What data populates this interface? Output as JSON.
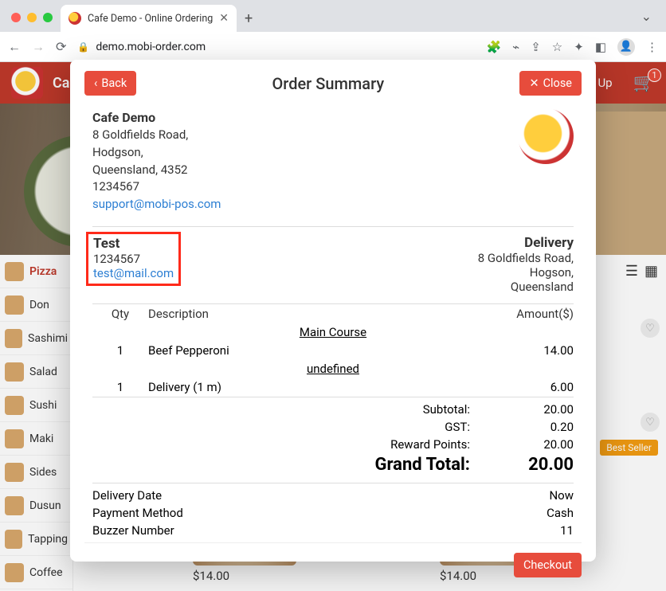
{
  "browser": {
    "tab_title": "Cafe Demo - Online Ordering",
    "url": "demo.mobi-order.com"
  },
  "header": {
    "brand_prefix": "Ca",
    "signup": "ng Up",
    "cart_count": "1"
  },
  "sidebar": {
    "items": [
      {
        "label": "Pizza"
      },
      {
        "label": "Don"
      },
      {
        "label": "Sashimi"
      },
      {
        "label": "Salad"
      },
      {
        "label": "Sushi"
      },
      {
        "label": "Maki"
      },
      {
        "label": "Sides"
      },
      {
        "label": "Dusun"
      },
      {
        "label": "Tapping"
      },
      {
        "label": "Coffee"
      }
    ]
  },
  "products": {
    "price": "$14.00",
    "best_seller": "Best Seller"
  },
  "modal": {
    "back": "Back",
    "close": "Close",
    "title": "Order Summary",
    "checkout": "Checkout",
    "store": {
      "name": "Cafe Demo",
      "addr1": "8 Goldfields Road,",
      "addr2": "Hodgson,",
      "addr3": "Queensland, 4352",
      "phone": "1234567",
      "email": "support@mobi-pos.com"
    },
    "customer": {
      "name": "Test",
      "phone": "1234567",
      "email": "test@mail.com"
    },
    "delivery": {
      "title": "Delivery",
      "addr1": "8 Goldfields Road,",
      "addr2": "Hogson,",
      "addr3": "Queensland"
    },
    "table": {
      "h_qty": "Qty",
      "h_desc": "Description",
      "h_amt": "Amount($)",
      "sec1": "Main Course",
      "r1_qty": "1",
      "r1_desc": "Beef Pepperoni",
      "r1_amt": "14.00",
      "sec2": "undefined",
      "r2_qty": "1",
      "r2_desc": "Delivery (1 m)",
      "r2_amt": "6.00"
    },
    "totals": {
      "subtotal_l": "Subtotal:",
      "subtotal_v": "20.00",
      "gst_l": "GST:",
      "gst_v": "0.20",
      "reward_l": "Reward Points:",
      "reward_v": "20.00",
      "grand_l": "Grand Total:",
      "grand_v": "20.00"
    },
    "meta": {
      "date_l": "Delivery Date",
      "date_v": "Now",
      "pay_l": "Payment Method",
      "pay_v": "Cash",
      "buzz_l": "Buzzer Number",
      "buzz_v": "11"
    }
  }
}
